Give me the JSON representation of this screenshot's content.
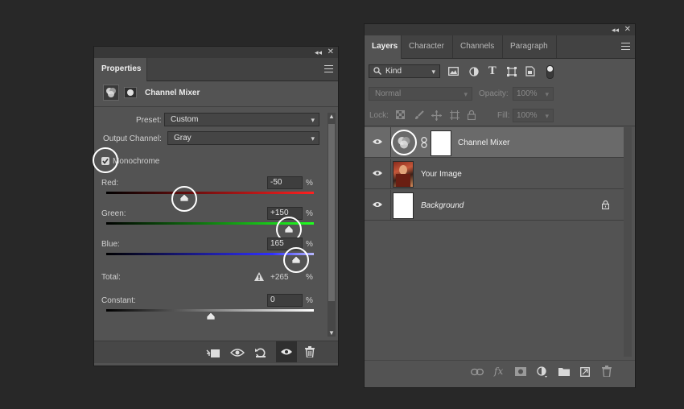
{
  "properties": {
    "tab_label": "Properties",
    "panel_title": "Channel Mixer",
    "preset_label": "Preset:",
    "preset_value": "Custom",
    "output_label": "Output Channel:",
    "output_value": "Gray",
    "monochrome_label": "Monochrome",
    "monochrome_checked": true,
    "red_label": "Red:",
    "red_value": "-50",
    "green_label": "Green:",
    "green_value": "+150",
    "blue_label": "Blue:",
    "blue_value": "165",
    "percent": "%",
    "total_label": "Total:",
    "total_value": "+265",
    "constant_label": "Constant:",
    "constant_value": "0",
    "red_level": -50,
    "green_level": 150,
    "blue_level": 165,
    "constant_level": 0,
    "slider_range": [
      -200,
      200
    ]
  },
  "layers": {
    "tabs": [
      "Layers",
      "Character",
      "Channels",
      "Paragraph"
    ],
    "active_tab": "Layers",
    "kind_label": "Kind",
    "blend_mode": "Normal",
    "opacity_label": "Opacity:",
    "opacity_value": "100%",
    "lock_label": "Lock:",
    "fill_label": "Fill:",
    "fill_value": "100%",
    "items": [
      {
        "name": "Channel Mixer",
        "type": "adjustment",
        "selected": true
      },
      {
        "name": "Your Image",
        "type": "image",
        "selected": false
      },
      {
        "name": "Background",
        "type": "background",
        "locked": true,
        "selected": false
      }
    ]
  },
  "colors": {
    "panel_bg": "#535353",
    "selected_row": "#6a6a6a",
    "highlight_circle": "#ffffff"
  }
}
